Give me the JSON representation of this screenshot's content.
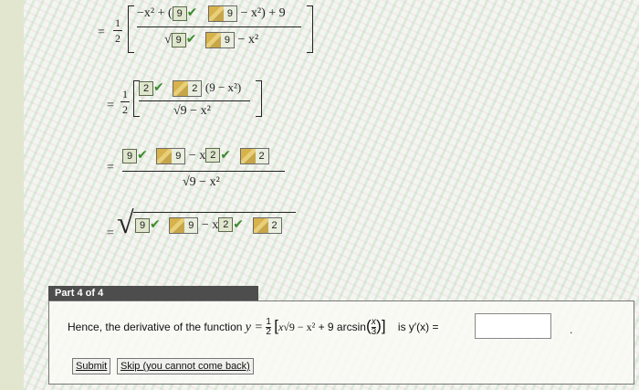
{
  "steps": [
    {
      "eq": "=",
      "coef_num": "1",
      "coef_den": "2",
      "num_a": "−x² + (",
      "box_a": "9",
      "box_b": "9",
      "num_b": "− x²) + 9",
      "den_a": "√",
      "box_c": "9",
      "box_d": "9",
      "den_b": "− x²"
    },
    {
      "eq": "=",
      "coef_num": "1",
      "coef_den": "2",
      "box_a": "2",
      "box_b": "2",
      "num_b": "(9 − x²)",
      "den": "√9 − x²"
    },
    {
      "eq": "=",
      "box_a": "9",
      "box_b": "9",
      "mid": "− x",
      "box_c": "2",
      "box_d": "2",
      "den": "√9 − x²"
    },
    {
      "eq": "=",
      "root": "√",
      "box_a": "9",
      "box_b": "9",
      "mid": "− x",
      "box_c": "2",
      "box_d": "2"
    }
  ],
  "part": {
    "header": "Part 4 of 4",
    "question_prefix": "Hence, the derivative of the function",
    "y_eq": "y =",
    "half_num": "1",
    "half_den": "2",
    "expr_x": "x",
    "expr_root": "√9 − x²",
    "expr_plus": "+ 9 arcsin",
    "arc_num": "x",
    "arc_den": "3",
    "is_label": "is y′(x) =",
    "input_value": "",
    "period": ".",
    "submit_label": "Submit",
    "skip_label": "Skip (you cannot come back)"
  }
}
